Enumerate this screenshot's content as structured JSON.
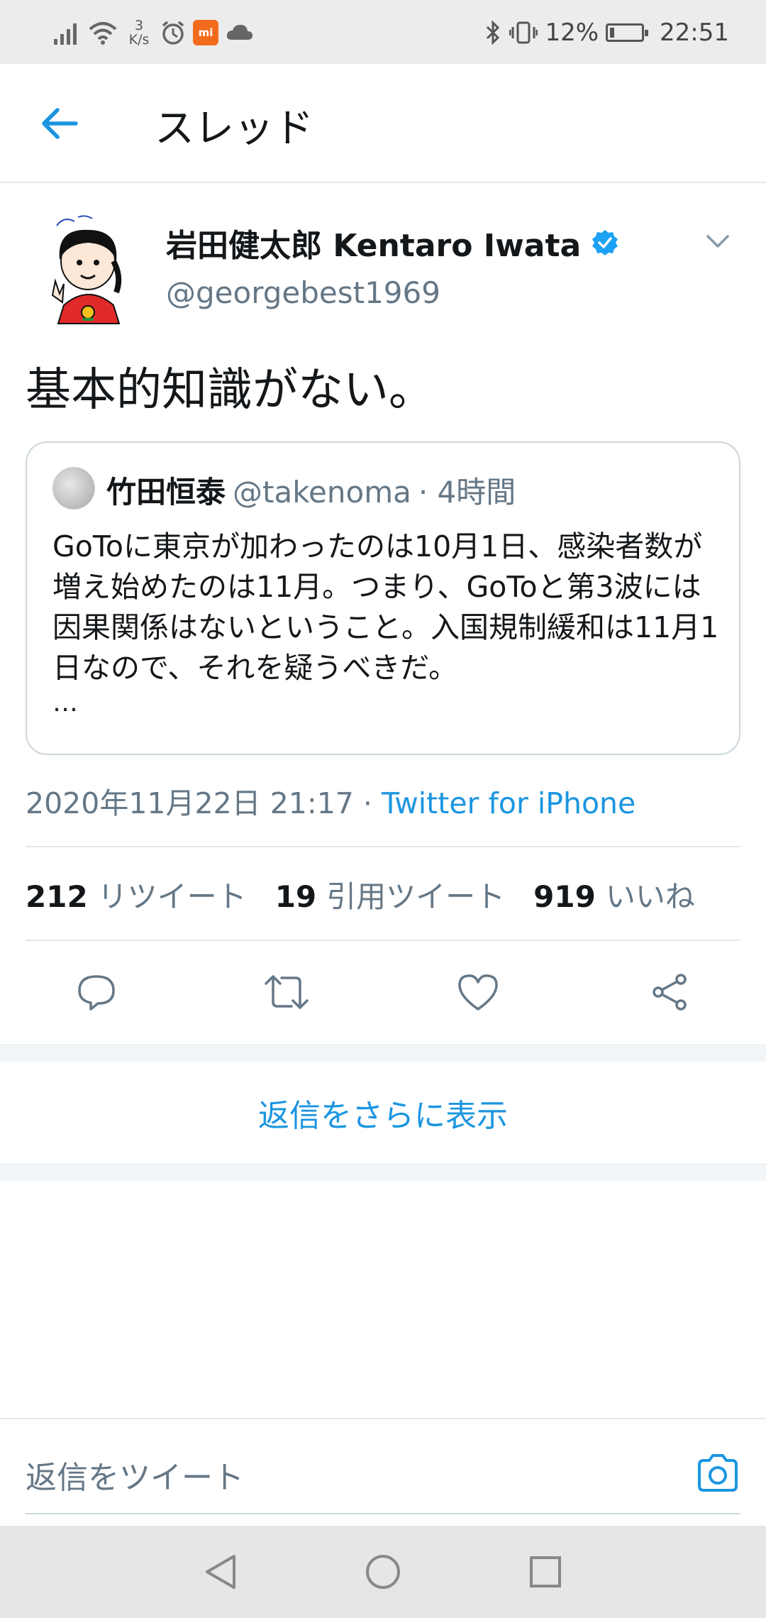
{
  "status_bar": {
    "net_speed_value": "3",
    "net_speed_unit": "K/s",
    "battery": "12%",
    "time": "22:51",
    "mi_label": "mi"
  },
  "header": {
    "title": "スレッド"
  },
  "tweet": {
    "author_name": "岩田健太郎 Kentaro Iwata",
    "author_handle": "@georgebest1969",
    "text": "基本的知識がない。",
    "quote": {
      "name": "竹田恒泰",
      "handle": "@takenoma",
      "time": "· 4時間",
      "text": "GoToに東京が加わったのは10月1日、感染者数が増え始めたのは11月。つまり、GoToと第3波には因果関係はないということ。入国規制緩和は11月1日なので、それを疑うべきだ。",
      "more": "…"
    },
    "timestamp": "2020年11月22日 21:17 · ",
    "source": "Twitter for iPhone",
    "stats": {
      "retweets_count": "212",
      "retweets_label": "リツイート",
      "quotes_count": "19",
      "quotes_label": "引用ツイート",
      "likes_count": "919",
      "likes_label": "いいね"
    }
  },
  "more_replies": "返信をさらに表示",
  "composer": {
    "placeholder": "返信をツイート"
  },
  "colors": {
    "accent": "#1b95e0",
    "secondary_text": "#657786",
    "divider": "#e1e8ed"
  }
}
